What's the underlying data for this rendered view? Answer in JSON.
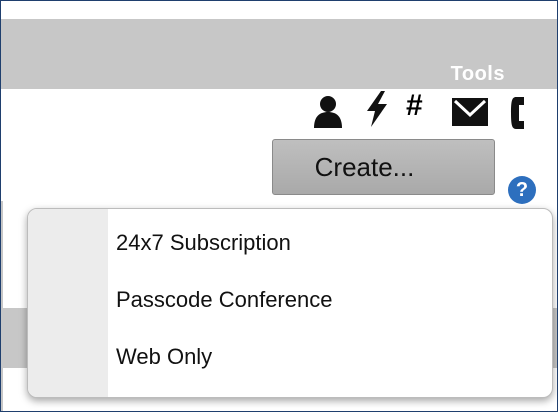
{
  "header": {
    "tools_label": "Tools"
  },
  "toolbar": {
    "icons": [
      "person-icon",
      "bolt-icon",
      "hash-icon",
      "mail-icon",
      "phone-icon"
    ],
    "hash_glyph": "#"
  },
  "create_button": {
    "label": "Create..."
  },
  "help": {
    "glyph": "?"
  },
  "dropdown": {
    "items": [
      {
        "label": "24x7 Subscription"
      },
      {
        "label": "Passcode Conference"
      },
      {
        "label": "Web Only"
      }
    ]
  },
  "colors": {
    "band": "#c7c7c7",
    "frame_border": "#1f3f6e",
    "help_blue": "#2d6fbe",
    "button_gray": "#b5b5b5"
  }
}
